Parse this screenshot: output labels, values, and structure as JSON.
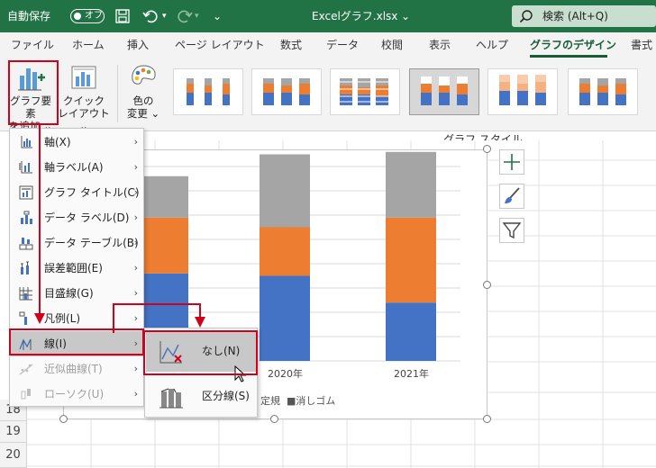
{
  "titlebar": {
    "autosave_label": "自動保存",
    "autosave_state": "オフ",
    "filename": "Excelグラフ.xlsx",
    "filename_caret": "⌄",
    "search_label": "検索 (Alt+Q)"
  },
  "tabs": [
    {
      "label": "ファイル"
    },
    {
      "label": "ホーム"
    },
    {
      "label": "挿入"
    },
    {
      "label": "ページ レイアウト"
    },
    {
      "label": "数式"
    },
    {
      "label": "データ"
    },
    {
      "label": "校閲"
    },
    {
      "label": "表示"
    },
    {
      "label": "ヘルプ"
    },
    {
      "label": "グラフのデザイン"
    },
    {
      "label": "書式"
    }
  ],
  "ribbon": {
    "add_element_line1": "グラフ要素",
    "add_element_line2": "を追加 ⌄",
    "quick_layout_line1": "クイック",
    "quick_layout_line2": "レイアウト ⌄",
    "change_color_line1": "色の",
    "change_color_line2": "変更 ⌄",
    "styles_group": "グラフ スタイル"
  },
  "rows": [
    "18",
    "19",
    "20"
  ],
  "chart": {
    "categories": [
      "2020年",
      "2021年"
    ],
    "legend_visible_text": "定規  ■消しゴム"
  },
  "chart_data": {
    "type": "bar",
    "stacked": true,
    "categories": [
      "",
      "2020年",
      "2021年"
    ],
    "series": [
      {
        "name": "",
        "color": "#4472c4",
        "values": [
          36,
          35,
          24
        ]
      },
      {
        "name": "定規",
        "color": "#ed7d31",
        "values": [
          23,
          20,
          35
        ]
      },
      {
        "name": "消しゴム",
        "color": "#a5a5a5",
        "values": [
          17,
          30,
          27
        ]
      }
    ]
  },
  "menu": {
    "items": [
      {
        "label": "軸(X)",
        "enabled": true
      },
      {
        "label": "軸ラベル(A)",
        "enabled": true
      },
      {
        "label": "グラフ タイトル(C)",
        "enabled": true
      },
      {
        "label": "データ ラベル(D)",
        "enabled": true
      },
      {
        "label": "データ テーブル(B)",
        "enabled": true
      },
      {
        "label": "誤差範囲(E)",
        "enabled": true
      },
      {
        "label": "目盛線(G)",
        "enabled": true
      },
      {
        "label": "凡例(L)",
        "enabled": true
      },
      {
        "label": "線(I)",
        "enabled": true
      },
      {
        "label": "近似曲線(T)",
        "enabled": false
      },
      {
        "label": "ローソク(U)",
        "enabled": false
      }
    ],
    "submenu": [
      {
        "label": "なし(N)"
      },
      {
        "label": "区分線(S)"
      }
    ],
    "arrow": "›"
  },
  "colors": {
    "accent": "#217346",
    "highlight_box": "#d0021b"
  }
}
